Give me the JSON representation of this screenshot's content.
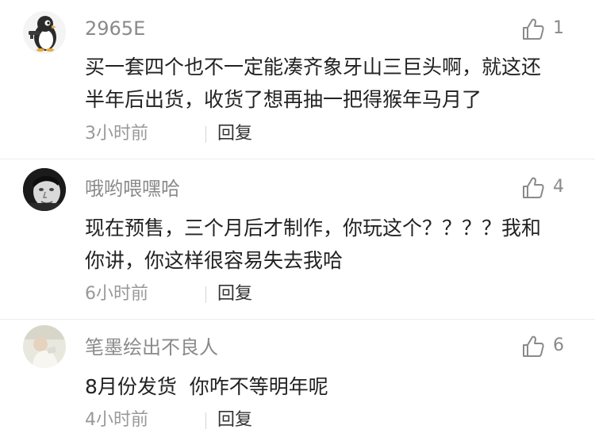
{
  "comments": [
    {
      "username": "2965E",
      "like_count": "1",
      "lines": [
        "买一套四个也不一定能凑齐象牙山三巨头啊，就这还",
        "半年后出货，收货了想再抽一把得猴年马月了"
      ],
      "time": "3小时前",
      "reply_label": "回复",
      "avatar_icon": "penguin-icon"
    },
    {
      "username": "哦哟喂嘿哈",
      "like_count": "4",
      "lines": [
        "现在预售，三个月后才制作，你玩这个？？？？我和",
        "你讲，你这样很容易失去我哈"
      ],
      "time": "6小时前",
      "reply_label": "回复",
      "avatar_icon": "man-portrait-icon"
    },
    {
      "username": "笔墨绘出不良人",
      "like_count": "6",
      "lines": [
        "8月份发货  你咋不等明年呢"
      ],
      "time": "4小时前",
      "reply_label": "回复",
      "avatar_icon": "person-photo-icon"
    }
  ],
  "icons": {
    "like": "thumbs-up-icon"
  },
  "colors": {
    "username": "#8a8a8a",
    "body_text": "#222222",
    "time": "#999999",
    "reply": "#333333",
    "background": "#ffffff"
  }
}
